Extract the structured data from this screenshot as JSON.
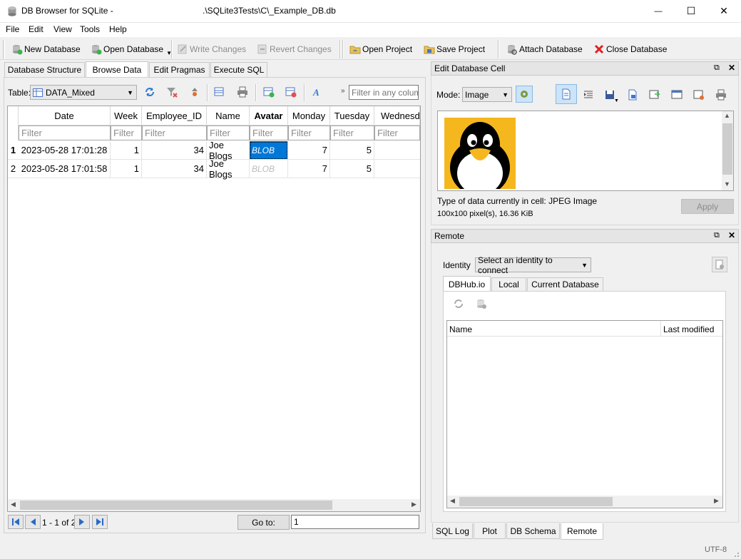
{
  "window": {
    "app_title": "DB Browser for SQLite -",
    "file_path": ".\\SQLite3Tests\\C\\_Example_DB.db",
    "minimize": "—",
    "maximize": "☐",
    "close": "✕"
  },
  "menu": [
    "File",
    "Edit",
    "View",
    "Tools",
    "Help"
  ],
  "toolbar": {
    "new_db": "New Database",
    "open_db": "Open Database",
    "write": "Write Changes",
    "revert": "Revert Changes",
    "open_project": "Open Project",
    "save_project": "Save Project",
    "attach": "Attach Database",
    "close_db": "Close Database"
  },
  "tabs": [
    "Database Structure",
    "Browse Data",
    "Edit Pragmas",
    "Execute SQL"
  ],
  "browse": {
    "table_label": "Table:",
    "table_value": "DATA_Mixed",
    "filter_placeholder": "Filter in any column",
    "columns": [
      "Date",
      "Week",
      "Employee_ID",
      "Name",
      "Avatar",
      "Monday",
      "Tuesday",
      "Wednesda"
    ],
    "filter_text": "Filter",
    "rows": [
      {
        "num": "1",
        "date": "2023-05-28 17:01:28",
        "week": "1",
        "emp": "34",
        "name": "Joe Blogs",
        "avatar": "BLOB",
        "mon": "7",
        "tue": "5",
        "wed": ""
      },
      {
        "num": "2",
        "date": "2023-05-28 17:01:58",
        "week": "1",
        "emp": "34",
        "name": "Joe Blogs",
        "avatar": "BLOB",
        "mon": "7",
        "tue": "5",
        "wed": ""
      }
    ],
    "pager": "1 - 1 of 2",
    "goto_label": "Go to:",
    "goto_value": "1"
  },
  "edit_cell": {
    "title": "Edit Database Cell",
    "mode_label": "Mode:",
    "mode_value": "Image",
    "type_text": "Type of data currently in cell: JPEG Image",
    "size_text": "100x100 pixel(s), 16.36 KiB",
    "apply": "Apply"
  },
  "remote": {
    "title": "Remote",
    "identity_label": "Identity",
    "identity_value": "Select an identity to connect",
    "tabs": [
      "DBHub.io",
      "Local",
      "Current Database"
    ],
    "col_name": "Name",
    "col_modified": "Last modified"
  },
  "bottom_tabs": [
    "SQL Log",
    "Plot",
    "DB Schema",
    "Remote"
  ],
  "status": {
    "encoding": "UTF-8"
  },
  "colors": {
    "selection": "#0078d7",
    "avatar_bg": "#f5b71e"
  }
}
